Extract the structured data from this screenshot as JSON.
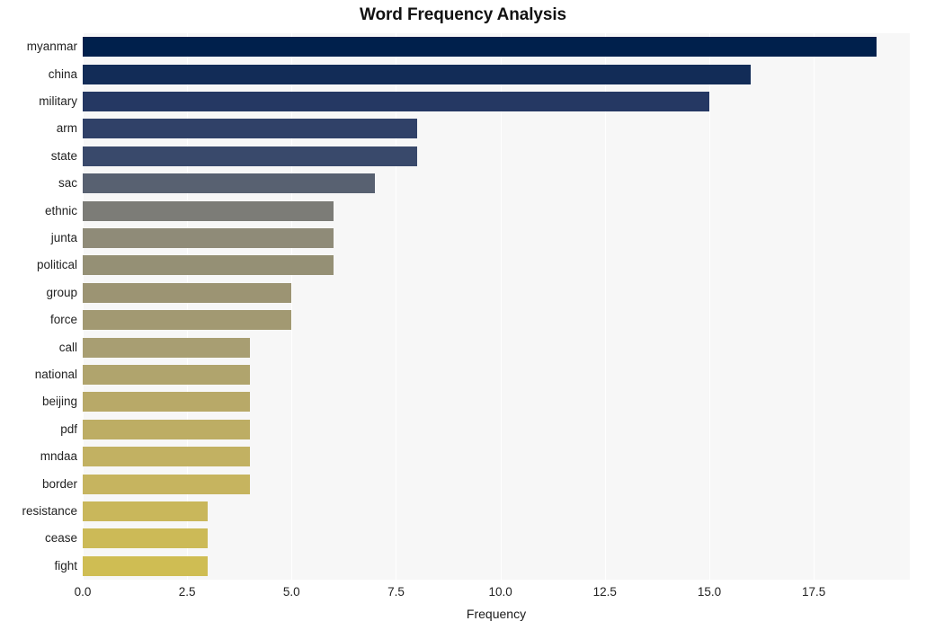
{
  "chart_data": {
    "type": "bar",
    "orientation": "horizontal",
    "title": "Word Frequency Analysis",
    "xlabel": "Frequency",
    "ylabel": "",
    "categories": [
      "myanmar",
      "china",
      "military",
      "arm",
      "state",
      "sac",
      "ethnic",
      "junta",
      "political",
      "group",
      "force",
      "call",
      "national",
      "beijing",
      "pdf",
      "mndaa",
      "border",
      "resistance",
      "cease",
      "fight"
    ],
    "values": [
      19,
      16,
      15,
      8,
      8,
      7,
      6,
      6,
      6,
      5,
      5,
      4,
      4,
      4,
      4,
      4,
      4,
      3,
      3,
      3
    ],
    "xlim": [
      0,
      19.8
    ],
    "xticks": [
      0,
      2.5,
      5,
      7.5,
      10,
      12.5,
      15,
      17.5
    ],
    "xtick_labels": [
      "0.0",
      "2.5",
      "5.0",
      "7.5",
      "10.0",
      "12.5",
      "15.0",
      "17.5"
    ],
    "grid": true,
    "grid_axis": "x",
    "legend": "none",
    "colormap": "cividis",
    "bar_colors": [
      "#04234f",
      "#273a65",
      "#3a4a6b",
      "#8d8a7a",
      "#8f8c7c",
      "#9a9373",
      "#a59b72",
      "#a79d72",
      "#a89e72",
      "#af a472",
      "#b0a572",
      "#bfae62",
      "#c0af61",
      "#c2b161",
      "#c3b161",
      "#c4b260",
      "#c5b360",
      "#cdbb55",
      "#cdbb54",
      "#cdbc54"
    ],
    "plot_background": "#f7f7f7",
    "grid_color": "#ffffff",
    "title_color": "#121212",
    "text_color": "#222222"
  }
}
